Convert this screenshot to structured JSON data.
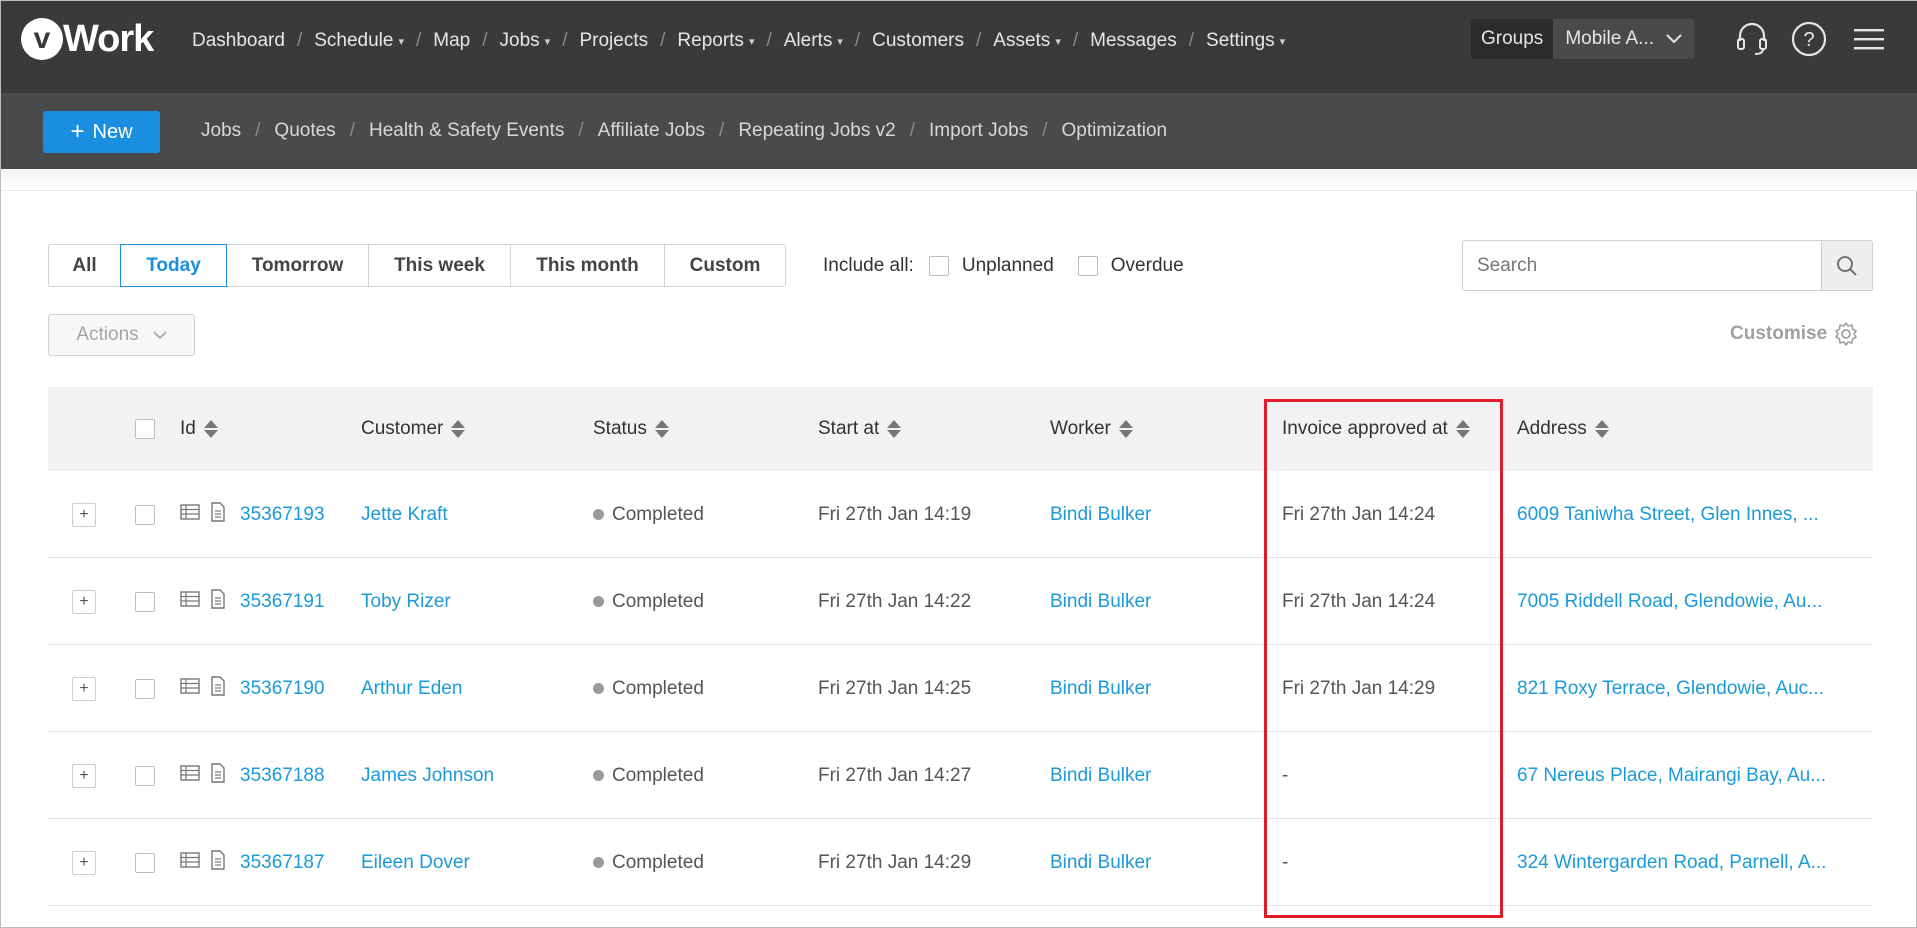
{
  "brand": {
    "logo_letter": "v",
    "logo_text": "Work"
  },
  "main_nav": [
    {
      "label": "Dashboard",
      "caret": false
    },
    {
      "label": "Schedule",
      "caret": true
    },
    {
      "label": "Map",
      "caret": false
    },
    {
      "label": "Jobs",
      "caret": true
    },
    {
      "label": "Projects",
      "caret": false
    },
    {
      "label": "Reports",
      "caret": true
    },
    {
      "label": "Alerts",
      "caret": true
    },
    {
      "label": "Customers",
      "caret": false
    },
    {
      "label": "Assets",
      "caret": true
    },
    {
      "label": "Messages",
      "caret": false
    },
    {
      "label": "Settings",
      "caret": true
    }
  ],
  "groups": {
    "label": "Groups",
    "selected": "Mobile A..."
  },
  "top_icons": [
    "headset-icon",
    "help-icon",
    "hamburger-menu-icon"
  ],
  "new_button": "New",
  "sub_nav": [
    "Jobs",
    "Quotes",
    "Health & Safety Events",
    "Affiliate Jobs",
    "Repeating Jobs v2",
    "Import Jobs",
    "Optimization"
  ],
  "date_filters": [
    {
      "label": "All",
      "active": false
    },
    {
      "label": "Today",
      "active": true
    },
    {
      "label": "Tomorrow",
      "active": false
    },
    {
      "label": "This week",
      "active": false
    },
    {
      "label": "This month",
      "active": false
    },
    {
      "label": "Custom",
      "active": false
    }
  ],
  "include": {
    "label": "Include all:",
    "options": [
      "Unplanned",
      "Overdue"
    ]
  },
  "search": {
    "placeholder": "Search",
    "value": ""
  },
  "actions_label": "Actions",
  "customise_label": "Customise",
  "columns": [
    "Id",
    "Customer",
    "Status",
    "Start at",
    "Worker",
    "Invoice approved at",
    "Address"
  ],
  "rows": [
    {
      "id": "35367193",
      "customer": "Jette Kraft",
      "status": "Completed",
      "start_at": "Fri 27th Jan 14:19",
      "worker": "Bindi Bulker",
      "invoice_approved_at": "Fri 27th Jan 14:24",
      "address": "6009 Taniwha Street, Glen Innes, ..."
    },
    {
      "id": "35367191",
      "customer": "Toby Rizer",
      "status": "Completed",
      "start_at": "Fri 27th Jan 14:22",
      "worker": "Bindi Bulker",
      "invoice_approved_at": "Fri 27th Jan 14:24",
      "address": "7005 Riddell Road, Glendowie, Au..."
    },
    {
      "id": "35367190",
      "customer": "Arthur Eden",
      "status": "Completed",
      "start_at": "Fri 27th Jan 14:25",
      "worker": "Bindi Bulker",
      "invoice_approved_at": "Fri 27th Jan 14:29",
      "address": "821 Roxy Terrace, Glendowie, Auc..."
    },
    {
      "id": "35367188",
      "customer": "James Johnson",
      "status": "Completed",
      "start_at": "Fri 27th Jan 14:27",
      "worker": "Bindi Bulker",
      "invoice_approved_at": "-",
      "address": "67 Nereus Place, Mairangi Bay, Au..."
    },
    {
      "id": "35367187",
      "customer": "Eileen Dover",
      "status": "Completed",
      "start_at": "Fri 27th Jan 14:29",
      "worker": "Bindi Bulker",
      "invoice_approved_at": "-",
      "address": "324 Wintergarden Road, Parnell, A..."
    }
  ],
  "colors": {
    "accent": "#1a8fe0",
    "link": "#1a9ad9",
    "topbar": "#3a3a3a",
    "subbar": "#4a4a4a",
    "highlight": "#e21b2a"
  }
}
